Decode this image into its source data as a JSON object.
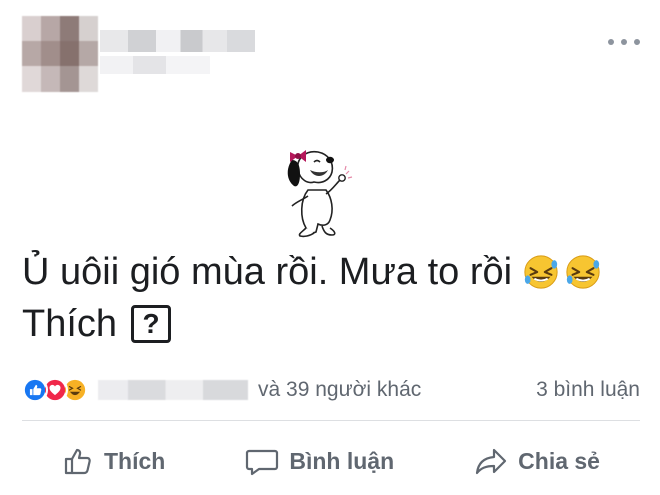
{
  "post": {
    "text_line_1": "Ủ uôii gió mùa rồi. Mưa to rồi",
    "text_line_2": "Thích",
    "unknown_glyph": "?"
  },
  "reactions": {
    "others_text": "và 39 người khác",
    "comment_count": "3 bình luận",
    "colors": {
      "like": "#1877f2",
      "love": "#f0284a",
      "haha": "#f7b125"
    }
  },
  "actions": {
    "like_label": "Thích",
    "comment_label": "Bình luận",
    "share_label": "Chia sẻ"
  }
}
